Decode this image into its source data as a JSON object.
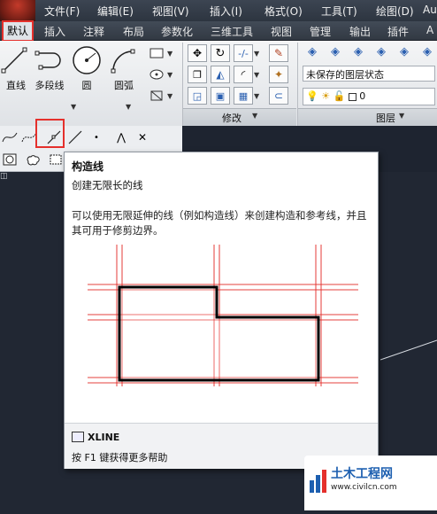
{
  "menubar": {
    "items": [
      "文件(F)",
      "编辑(E)",
      "视图(V)",
      "插入(I)",
      "格式(O)",
      "工具(T)",
      "绘图(D)",
      "Au"
    ]
  },
  "ribbon_tabs": {
    "items": [
      "默认",
      "插入",
      "注释",
      "布局",
      "参数化",
      "三维工具",
      "视图",
      "管理",
      "输出",
      "插件",
      "A"
    ],
    "active": "默认"
  },
  "draw_panel": {
    "tools": [
      "直线",
      "多段线",
      "圆",
      "圆弧"
    ]
  },
  "modify_panel": {
    "label": "修改"
  },
  "layers_panel": {
    "label": "图层",
    "state": "未保存的图层状态",
    "current_layer": "0"
  },
  "tooltip": {
    "title": "构造线",
    "subtitle": "创建无限长的线",
    "description": "可以使用无限延伸的线（例如构造线）来创建构造和参考线，并且其可用于修剪边界。",
    "command": "XLINE",
    "help": "按 F1 键获得更多帮助"
  },
  "watermark": {
    "title": "土木工程网",
    "url": "www.civilcn.com"
  },
  "colors": {
    "highlight": "#e5302c",
    "construction_line": "#e5302c",
    "canvas": "#212733"
  }
}
